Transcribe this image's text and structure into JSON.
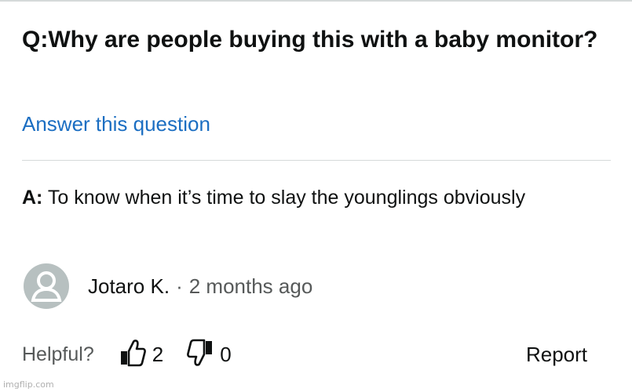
{
  "question": {
    "prefix": "Q:",
    "text": "Why are people buying this with a baby monitor?"
  },
  "answer_link": "Answer this question",
  "answer": {
    "prefix": "A:",
    "text": " To know when it’s time to slay the younglings obviously"
  },
  "author": {
    "name": "Jotaro K.",
    "separator": "·",
    "time": "2 months ago",
    "avatar_icon": "user-silhouette-icon"
  },
  "votes": {
    "helpful_label": "Helpful?",
    "up_count": "2",
    "down_count": "0",
    "up_icon": "thumbs-up-icon",
    "down_icon": "thumbs-down-icon",
    "report_label": "Report"
  },
  "watermark": "imgflip.com",
  "colors": {
    "link": "#1b6ec2",
    "text": "#0f1111",
    "muted": "#565959",
    "divider": "#d5d9d9",
    "avatar_bg": "#b7c0c0"
  }
}
